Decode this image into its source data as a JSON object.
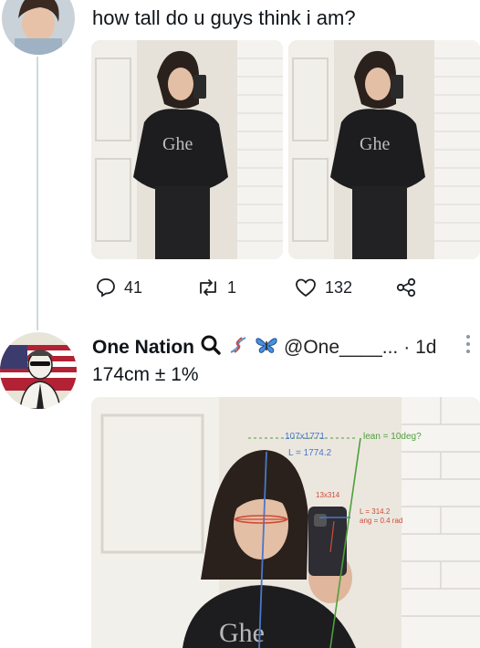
{
  "tweet1": {
    "text": "how tall do u guys think i am?",
    "replies": "41",
    "retweets": "1",
    "likes": "132"
  },
  "tweet2": {
    "name": "One Nation",
    "handle": "@One____...",
    "time": "· 1d",
    "text": "174cm ± 1%",
    "emoji_icons": [
      "search-icon",
      "dna-icon",
      "butterfly-icon"
    ]
  },
  "annotations": {
    "measure1": "107x1771",
    "measure2": "L = 1774.2",
    "lean": "lean = 10deg?",
    "box": "13x314",
    "angle1": "L = 314.2",
    "angle2": "ang = 0.4 rad"
  },
  "colors": {
    "thread_line": "#cfd9de",
    "muted": "#8b98a5",
    "annotation_blue": "#4a77c8",
    "annotation_green": "#4f9f3a",
    "annotation_red": "#d04a35"
  }
}
